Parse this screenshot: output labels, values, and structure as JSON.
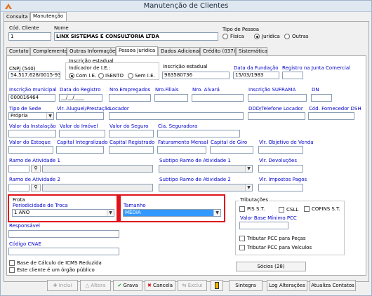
{
  "window": {
    "title": "Manutenção de Clientes"
  },
  "top_tabs": [
    "Consulta",
    "Manutenção"
  ],
  "header": {
    "cod_label": "Cód. Cliente",
    "cod_value": "1",
    "nome_label": "Nome",
    "nome_value": "LINX SISTEMAS E CONSULTORIA LTDA",
    "tipo_label": "Tipo de Pessoa",
    "tipo_options": [
      "Física",
      "Jurídica",
      "Outras"
    ]
  },
  "sub_tabs": [
    "Contato",
    "Complemento",
    "Outras Informações",
    "Pessoa Jurídica",
    "Dados Adicionais",
    "Crédito (037)",
    "Sistemática"
  ],
  "pj": {
    "cnpj_label": "CNPJ (540)",
    "cnpj_value": "54.517.628/0015-93",
    "ie_group_label": "Inscrição estadual",
    "ie_indicador_label": "Indicador de I.E.:",
    "ie_options": [
      "Com I.E.",
      "ISENTO",
      "Sem I.E."
    ],
    "ie_label": "Inscrição estadual",
    "ie_value": "963580736",
    "fundacao_label": "Data da Fundação",
    "fundacao_value": "15/03/1983",
    "registro_junta_label": "Registro na Junta Comercial",
    "insc_municipal_label": "Inscrição municipal",
    "insc_municipal_value": "000016464",
    "data_registro_label": "Data do Registro",
    "data_registro_value": "__/__/____",
    "nro_empregados_label": "Nro.Empregados",
    "nro_filiais_label": "Nro.Filiais",
    "nro_alvara_label": "Nro. Alvará",
    "insc_suframa_label": "Inscrição SUFRAMA",
    "dn_label": "DN",
    "tipo_sede_label": "Tipo de Sede",
    "tipo_sede_value": "Própria",
    "vlr_aluguel_label": "Vlr. Aluguel/Prestação",
    "locador_label": "Locador",
    "ddd_tel_locador_label": "DDD/Telefone Locador",
    "cod_fornecedor_label": "Cód. Fornecedor DSH",
    "valor_instalacao_label": "Valor da Instalação",
    "valor_imovel_label": "Valor do Imóvel",
    "valor_seguro_label": "Valor do Seguro",
    "cia_seguradora_label": "Cia. Seguradora",
    "valor_estoque_label": "Valor do Estoque",
    "capital_integralizado_label": "Capital Integralizado",
    "capital_registrado_label": "Capital Registrado",
    "faturamento_label": "Faturamento Mensal",
    "capital_giro_label": "Capital de Giro",
    "vlr_objetivo_label": "Vlr. Objetivo de Venda",
    "ramo1_label": "Ramo de Atividade 1",
    "subtipo1_label": "Subtipo Ramo de Atividade 1",
    "vlr_devolucoes_label": "Vlr. Devoluções",
    "ramo2_label": "Ramo de Atividade 2",
    "subtipo2_label": "Subtipo Ramo de Atividade 2",
    "vlr_impostos_label": "Vlr. Impostos Pagos",
    "frota_label": "Frota",
    "periodicidade_label": "Periodicidade de Troca",
    "periodicidade_value": "1 ANO",
    "tamanho_label": "Tamanho",
    "tamanho_value": "MÉDIA",
    "tributacoes_label": "Tributações",
    "trib_checks": [
      "PIS S.T.",
      "CSLL",
      "COFINS S.T."
    ],
    "valor_base_pcc_label": "Valor Base Mínimo PCC",
    "trib_pcc_pecas": "Tributar PCC para Peças",
    "trib_pcc_veiculos": "Tributar PCC para Veículos",
    "socios_button": "Sócios (28)",
    "responsavel_label": "Responsável",
    "codigo_cnae_label": "Código CNAE",
    "base_icms_label": "Base de Cálculo de ICMS Reduzida",
    "orgao_publico_label": "Este cliente é um órgão público"
  },
  "toolbar": {
    "inclui": "Inclui",
    "altera": "Altera",
    "grava": "Grava",
    "cancela": "Cancela",
    "exclui": "Exclui",
    "sintegra": "Sintegra",
    "log": "Log Alterações",
    "atualiza": "Atualiza Contatos"
  },
  "colors": {
    "highlight_box": "#e0121b",
    "label_blue": "#0000cc",
    "selection": "#3399ff"
  }
}
